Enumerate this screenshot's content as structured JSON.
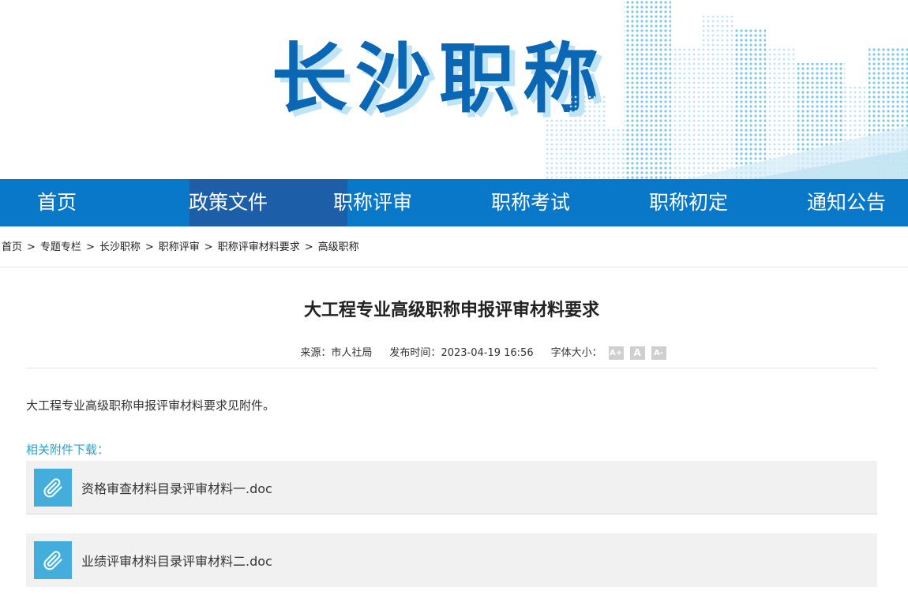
{
  "banner": {
    "title": "长沙职称"
  },
  "nav": {
    "items": [
      {
        "label": "首页"
      },
      {
        "label": "政策文件"
      },
      {
        "label": "职称评审"
      },
      {
        "label": "职称考试"
      },
      {
        "label": "职称初定"
      },
      {
        "label": "通知公告"
      }
    ],
    "active_index": 1
  },
  "breadcrumb": {
    "items": [
      "首页",
      "专题专栏",
      "长沙职称",
      "职称评审",
      "职称评审材料要求",
      "高级职称"
    ],
    "separator": ">"
  },
  "article": {
    "title": "大工程专业高级职称申报评审材料要求",
    "source_label": "来源：",
    "source_value": "市人社局",
    "time_label": "发布时间：",
    "time_value": "2023-04-19 16:56",
    "font_size_label": "字体大小：",
    "font_buttons": [
      "A+",
      "A",
      "A-"
    ],
    "body": "大工程专业高级职称申报评审材料要求见附件。",
    "attachments_label": "相关附件下载：",
    "attachments": [
      {
        "name": "资格审查材料目录评审材料一.doc",
        "icon": "paperclip-icon"
      },
      {
        "name": "业绩评审材料目录评审材料二.doc",
        "icon": "paperclip-icon"
      }
    ]
  },
  "colors": {
    "nav_bg": "#0a78c8",
    "nav_active": "#1c5fa8",
    "title_blue": "#0b66b4",
    "attach_label": "#2f9fc4",
    "attach_icon_bg": "#43aedc"
  }
}
